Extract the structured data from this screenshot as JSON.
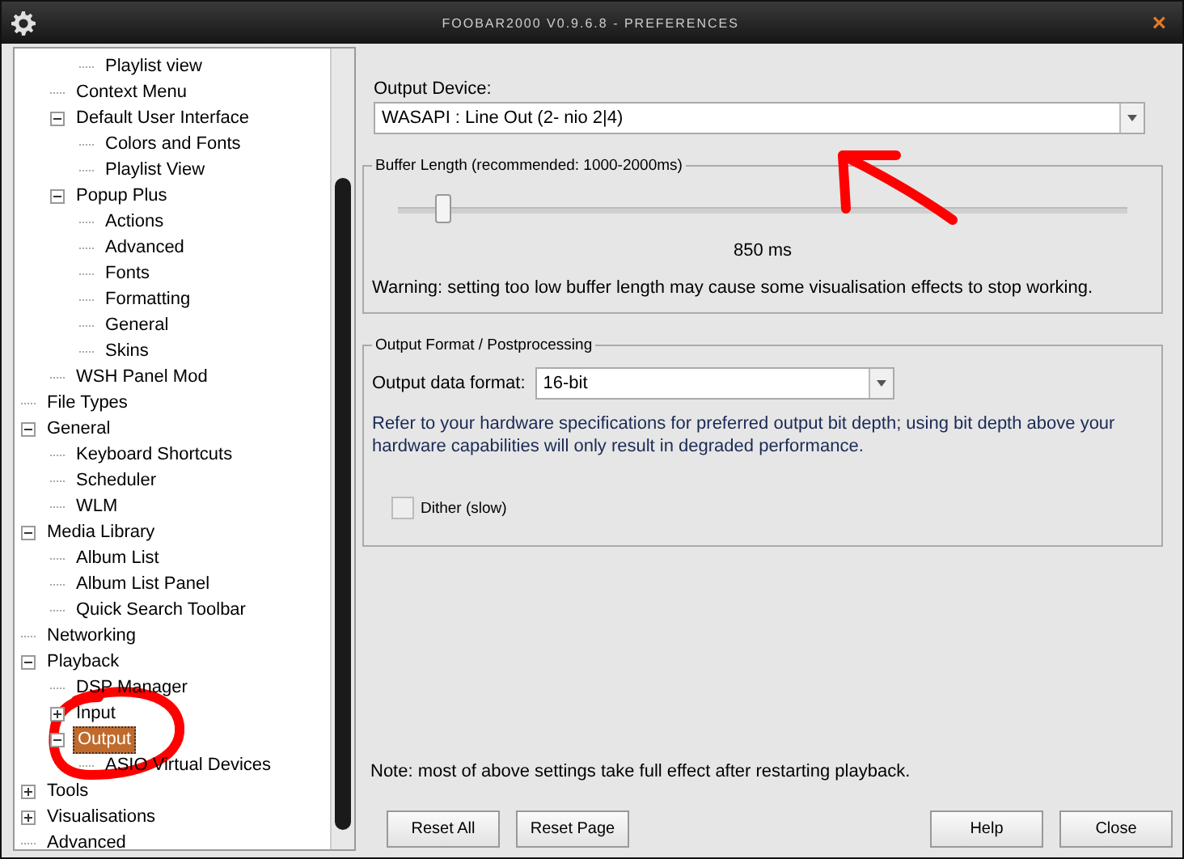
{
  "window": {
    "title": "FOOBAR2000 V0.9.6.8 - PREFERENCES",
    "close": "×"
  },
  "tree": {
    "items": [
      {
        "children": [
          {
            "children": [
              {
                "label": "Playlist view",
                "selected": false
              }
            ]
          },
          {
            "label": "Context Menu",
            "selected": false
          },
          {
            "label": "Default User Interface",
            "selected": false,
            "expanded": true,
            "children": [
              {
                "label": "Colors and Fonts",
                "selected": false
              },
              {
                "label": "Playlist View",
                "selected": false
              }
            ]
          },
          {
            "label": "Popup Plus",
            "selected": false,
            "expanded": true,
            "children": [
              {
                "label": "Actions",
                "selected": false
              },
              {
                "label": "Advanced",
                "selected": false
              },
              {
                "label": "Fonts",
                "selected": false
              },
              {
                "label": "Formatting",
                "selected": false
              },
              {
                "label": "General",
                "selected": false
              },
              {
                "label": "Skins",
                "selected": false
              }
            ]
          },
          {
            "label": "WSH Panel Mod",
            "selected": false
          }
        ]
      },
      {
        "label": "File Types",
        "selected": false
      },
      {
        "label": "General",
        "selected": false,
        "expanded": true,
        "children": [
          {
            "label": "Keyboard Shortcuts",
            "selected": false
          },
          {
            "label": "Scheduler",
            "selected": false
          },
          {
            "label": "WLM",
            "selected": false
          }
        ]
      },
      {
        "label": "Media Library",
        "selected": false,
        "expanded": true,
        "children": [
          {
            "label": "Album List",
            "selected": false
          },
          {
            "label": "Album List Panel",
            "selected": false
          },
          {
            "label": "Quick Search Toolbar",
            "selected": false
          }
        ]
      },
      {
        "label": "Networking",
        "selected": false
      },
      {
        "label": "Playback",
        "selected": false,
        "expanded": true,
        "children": [
          {
            "label": "DSP Manager",
            "selected": false
          },
          {
            "label": "Input",
            "selected": false,
            "expanded": false
          },
          {
            "label": "Output",
            "selected": true,
            "expanded": true,
            "children": [
              {
                "label": "ASIO Virtual Devices",
                "selected": false
              }
            ]
          }
        ]
      },
      {
        "label": "Tools",
        "selected": false,
        "expanded": false
      },
      {
        "label": "Visualisations",
        "selected": false,
        "expanded": false
      },
      {
        "label": "Advanced",
        "selected": false
      }
    ]
  },
  "output_device": {
    "label": "Output Device:",
    "value": "WASAPI : Line Out (2- nio 2|4)"
  },
  "buffer": {
    "title": "Buffer Length (recommended: 1000-2000ms)",
    "level": 0.05,
    "reading": "850 ms",
    "warning": "Warning: setting too low buffer length may cause some visualisation effects to stop working."
  },
  "format": {
    "title": "Output Format / Postprocessing",
    "label": "Output data format:",
    "value": "16-bit",
    "note": "Refer to your hardware specifications for preferred output bit depth; using bit depth above your hardware capabilities will only result in degraded performance.",
    "dither": {
      "label": "Dither (slow)",
      "checked": false
    }
  },
  "note": "Note: most of above settings take full effect after restarting playback.",
  "buttons": [
    "Reset All",
    "Reset Page",
    "Help",
    "Close"
  ]
}
